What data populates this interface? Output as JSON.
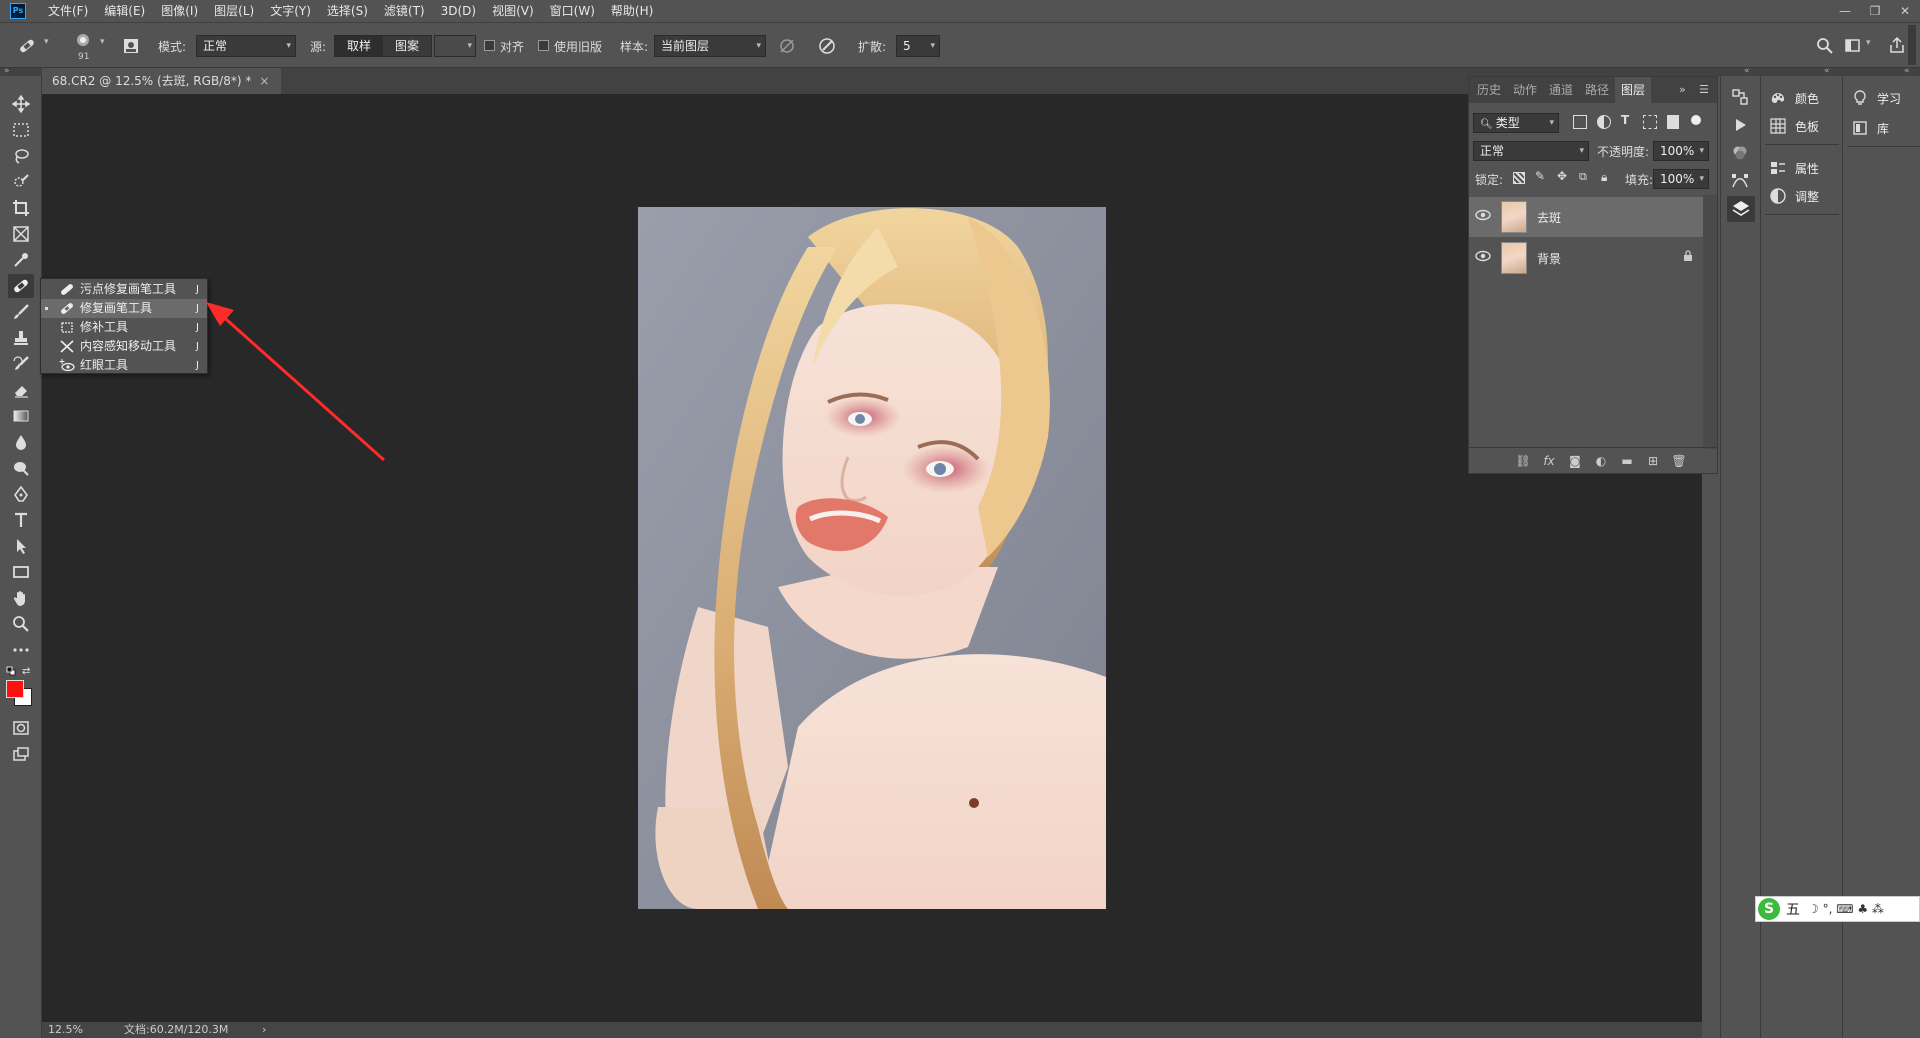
{
  "menubar": {
    "items": [
      "文件(F)",
      "编辑(E)",
      "图像(I)",
      "图层(L)",
      "文字(Y)",
      "选择(S)",
      "滤镜(T)",
      "3D(D)",
      "视图(V)",
      "窗口(W)",
      "帮助(H)"
    ],
    "logo": "Ps"
  },
  "options": {
    "brush_size": "91",
    "mode_label": "模式:",
    "mode_value": "正常",
    "source_label": "源:",
    "source_sample": "取样",
    "source_pattern": "图案",
    "align_label": "对齐",
    "legacy_label": "使用旧版",
    "sample_label": "样本:",
    "sample_value": "当前图层",
    "diffusion_label": "扩散:",
    "diffusion_value": "5"
  },
  "document": {
    "tab_title": "68.CR2 @ 12.5% (去斑, RGB/8*) *",
    "close": "×"
  },
  "status": {
    "zoom": "12.5%",
    "doc_size": "文档:60.2M/120.3M",
    "arrow": "›"
  },
  "flyout": {
    "items": [
      {
        "label": "污点修复画笔工具",
        "key": "J",
        "selected": false
      },
      {
        "label": "修复画笔工具",
        "key": "J",
        "selected": true
      },
      {
        "label": "修补工具",
        "key": "J",
        "selected": false
      },
      {
        "label": "内容感知移动工具",
        "key": "J",
        "selected": false
      },
      {
        "label": "红眼工具",
        "key": "J",
        "selected": false
      }
    ]
  },
  "layers_panel": {
    "tabs": [
      "历史",
      "动作",
      "通道",
      "路径",
      "图层"
    ],
    "active_tab": "图层",
    "filter_value": "类型",
    "blend_mode": "正常",
    "opacity_label": "不透明度:",
    "opacity_value": "100%",
    "lock_label": "锁定:",
    "fill_label": "填充:",
    "fill_value": "100%",
    "layers": [
      {
        "name": "去斑",
        "selected": true,
        "locked": false
      },
      {
        "name": "背景",
        "selected": false,
        "locked": true
      }
    ]
  },
  "dock": {
    "color": "颜色",
    "swatches": "色板",
    "properties": "属性",
    "adjustments": "调整",
    "learn": "学习",
    "libraries": "库"
  },
  "ime": {
    "logo": "S",
    "mode": "五",
    "glyphs": "☽ °, ⌨ ♣ ⁂"
  },
  "colors": {
    "foreground": "#ff1010",
    "background": "#ffffff",
    "annotation_arrow": "#ff2a2a"
  }
}
